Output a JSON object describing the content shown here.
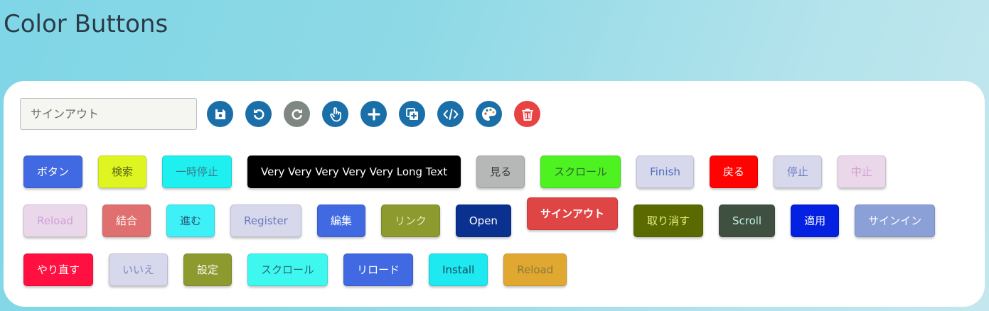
{
  "page": {
    "title": "Color Buttons"
  },
  "toolbar": {
    "input_placeholder": "サインアウト",
    "icons": [
      {
        "name": "save-icon",
        "color": "#1a6fa8"
      },
      {
        "name": "undo-icon",
        "color": "#1a6fa8"
      },
      {
        "name": "redo-icon",
        "color": "#7f8783"
      },
      {
        "name": "hand-pointer-icon",
        "color": "#1a6fa8"
      },
      {
        "name": "plus-icon",
        "color": "#1a6fa8"
      },
      {
        "name": "duplicate-icon",
        "color": "#1a6fa8"
      },
      {
        "name": "code-icon",
        "color": "#1a6fa8"
      },
      {
        "name": "palette-icon",
        "color": "#1a6fa8"
      },
      {
        "name": "trash-icon",
        "color": "#e74343"
      }
    ]
  },
  "rows": [
    [
      {
        "label": "ボタン",
        "bg": "#4169e1",
        "fg": "#ffffff"
      },
      {
        "label": "検索",
        "bg": "#dff521",
        "fg": "#5a6a1a"
      },
      {
        "label": "一時停止",
        "bg": "#1ef0f0",
        "fg": "#3a7a8a"
      },
      {
        "label": "Very Very Very Very Very Long Text",
        "bg": "#000000",
        "fg": "#ffffff"
      },
      {
        "label": "見る",
        "bg": "#b5b8b6",
        "fg": "#3a3a3a"
      },
      {
        "label": "スクロール",
        "bg": "#4ef221",
        "fg": "#2a6a2a"
      },
      {
        "label": "Finish",
        "bg": "#d8d8ec",
        "fg": "#4a6ac0"
      },
      {
        "label": "戻る",
        "bg": "#ff0303",
        "fg": "#ffffff"
      },
      {
        "label": "停止",
        "bg": "#d8d8ec",
        "fg": "#6a7ac0"
      },
      {
        "label": "中止",
        "bg": "#ead8ea",
        "fg": "#d0a0d0"
      }
    ],
    [
      {
        "label": "Reload",
        "bg": "#ead8ea",
        "fg": "#d0a0d8"
      },
      {
        "label": "結合",
        "bg": "#e07070",
        "fg": "#ffffff"
      },
      {
        "label": "進む",
        "bg": "#3ef0f8",
        "fg": "#2a5a7a"
      },
      {
        "label": "Register",
        "bg": "#d8d8ec",
        "fg": "#6a7ac0"
      },
      {
        "label": "編集",
        "bg": "#4169e1",
        "fg": "#ffffff"
      },
      {
        "label": "リンク",
        "bg": "#8c9a2e",
        "fg": "#e0e8c0"
      },
      {
        "label": "Open",
        "bg": "#0a3090",
        "fg": "#ffffff"
      },
      {
        "label": "サインアウト",
        "bg": "#e04545",
        "fg": "#ffffff",
        "bold": true,
        "lift": true
      },
      {
        "label": "取り消す",
        "bg": "#5a6a00",
        "fg": "#e8f080"
      },
      {
        "label": "Scroll",
        "bg": "#405040",
        "fg": "#c0f0e0"
      },
      {
        "label": "適用",
        "bg": "#0420e0",
        "fg": "#ffffff"
      },
      {
        "label": "サインイン",
        "bg": "#8ca0d8",
        "fg": "#ffffff"
      }
    ],
    [
      {
        "label": "やり直す",
        "bg": "#ff1040",
        "fg": "#ffffff"
      },
      {
        "label": "いいえ",
        "bg": "#d8d8ec",
        "fg": "#7a8ac0"
      },
      {
        "label": "設定",
        "bg": "#8c9a2e",
        "fg": "#ffffff"
      },
      {
        "label": "スクロール",
        "bg": "#3ef8f0",
        "fg": "#2a6a7a"
      },
      {
        "label": "リロード",
        "bg": "#4169e1",
        "fg": "#ffffff"
      },
      {
        "label": "Install",
        "bg": "#1ee8f0",
        "fg": "#1a4a5a"
      },
      {
        "label": "Reload",
        "bg": "#e0a830",
        "fg": "#8a7a3a"
      }
    ]
  ]
}
